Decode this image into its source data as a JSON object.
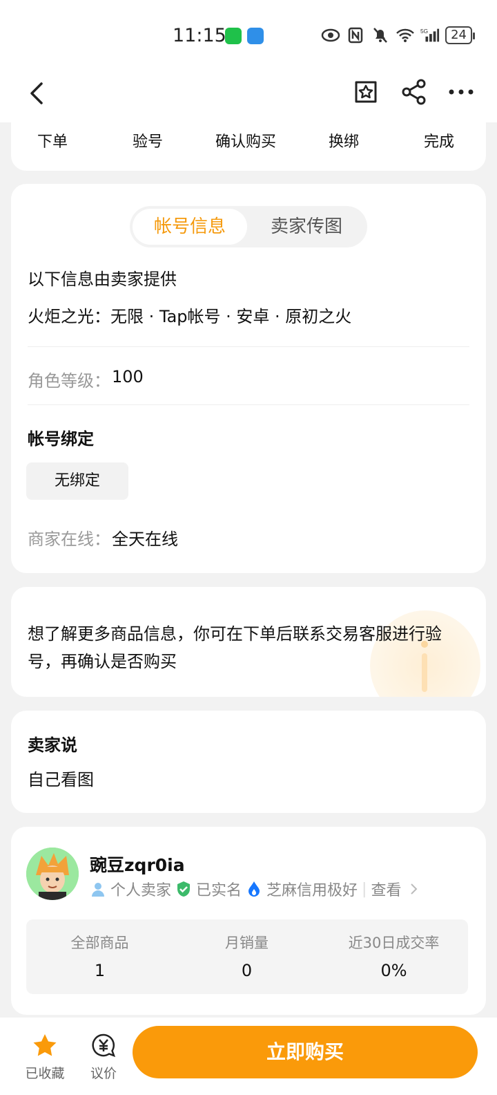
{
  "status_bar": {
    "time": "11:15",
    "battery": "24",
    "network": "5G"
  },
  "nav": {
    "icons": [
      "back-icon",
      "favorite-icon",
      "share-icon",
      "more-icon"
    ]
  },
  "steps": [
    "下单",
    "验号",
    "确认购买",
    "换绑",
    "完成"
  ],
  "tabs": {
    "active": "帐号信息",
    "inactive": "卖家传图"
  },
  "account_info": {
    "provided_note": "以下信息由卖家提供",
    "game_line": "火炬之光：无限 · Tap帐号 · 安卓 · 原初之火",
    "level_label": "角色等级：",
    "level_value": "100",
    "binding_title": "帐号绑定",
    "binding_value": "无绑定",
    "online_label": "商家在线：",
    "online_value": "全天在线"
  },
  "tip": {
    "text": "想了解更多商品信息，你可在下单后联系交易客服进行验号，再确认是否购买"
  },
  "seller_say": {
    "title": "卖家说",
    "content": "自己看图"
  },
  "seller": {
    "name": "豌豆zqr0ia",
    "tag_personal": "个人卖家",
    "tag_verified": "已实名",
    "tag_credit": "芝麻信用极好",
    "view_link": "查看",
    "stats": [
      {
        "label": "全部商品",
        "value": "1"
      },
      {
        "label": "月销量",
        "value": "0"
      },
      {
        "label": "近30日成交率",
        "value": "0%"
      }
    ]
  },
  "bottom": {
    "favorited": "已收藏",
    "bargain": "议价",
    "buy_now": "立即购买"
  },
  "colors": {
    "accent": "#fa9a0a",
    "tab_active": "#f59a0d"
  }
}
